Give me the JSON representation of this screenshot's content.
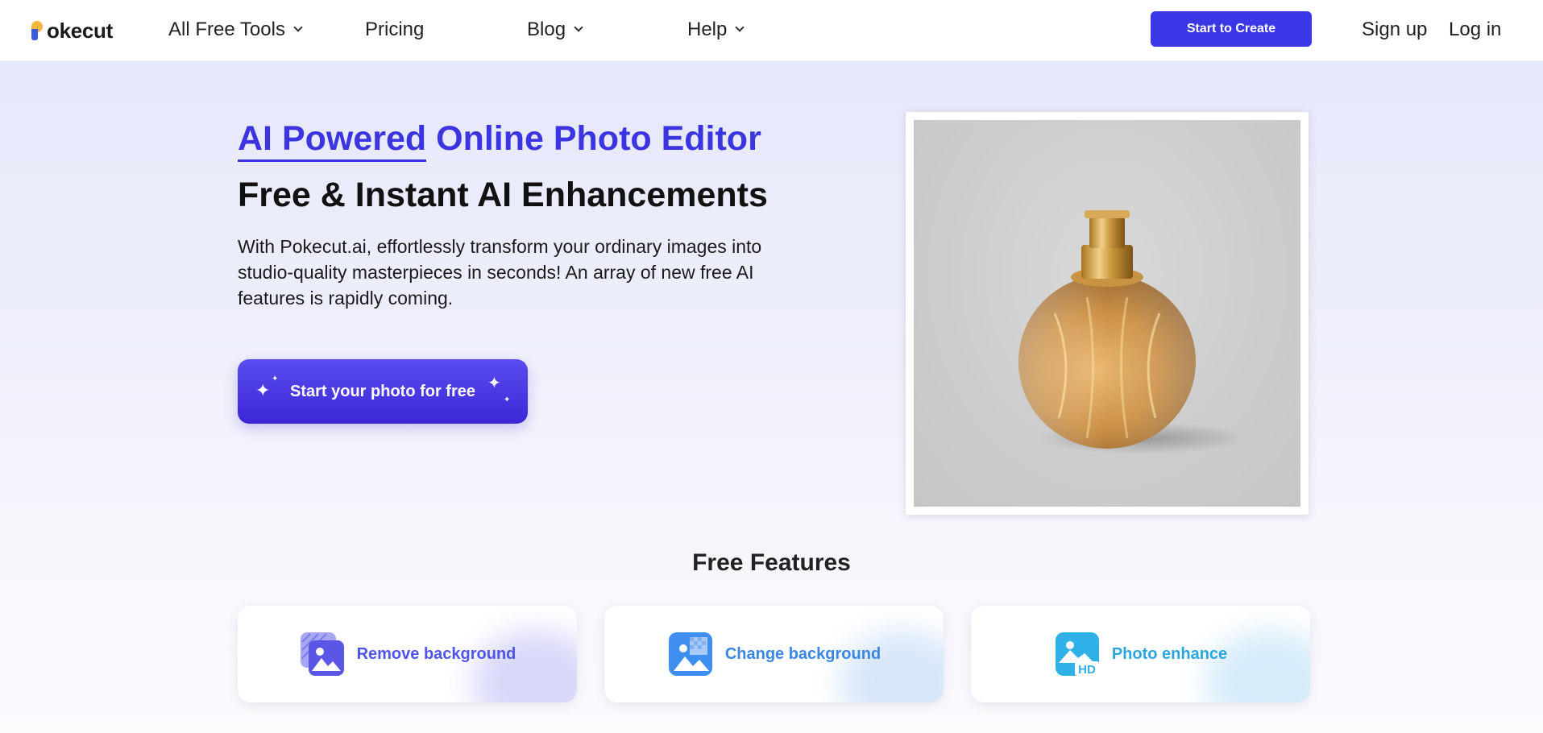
{
  "brand": {
    "logo_text": "okecut"
  },
  "nav": {
    "tools_label": "All Free Tools",
    "pricing_label": "Pricing",
    "blog_label": "Blog",
    "help_label": "Help",
    "cta_label": "Start to Create",
    "signup_label": "Sign up",
    "login_label": "Log in"
  },
  "hero": {
    "title_highlight": "AI Powered",
    "title_rest": " Online Photo Editor",
    "subtitle": "Free & Instant AI Enhancements",
    "description": "With Pokecut.ai, effortlessly transform your ordinary images into studio-quality masterpieces in seconds! An array of new free AI features is rapidly coming.",
    "cta_label": "Start your photo for free"
  },
  "features": {
    "title": "Free Features",
    "items": [
      {
        "label": "Remove background",
        "color": "#4f55e8",
        "icon": "remove-background-icon"
      },
      {
        "label": "Change background",
        "color": "#3a86e4",
        "icon": "change-background-icon"
      },
      {
        "label": "Photo enhance",
        "color": "#2aa6df",
        "icon": "photo-enhance-hd-icon"
      }
    ]
  },
  "colors": {
    "accent": "#3b37e6",
    "hero_bg": "#e6e8fb"
  }
}
